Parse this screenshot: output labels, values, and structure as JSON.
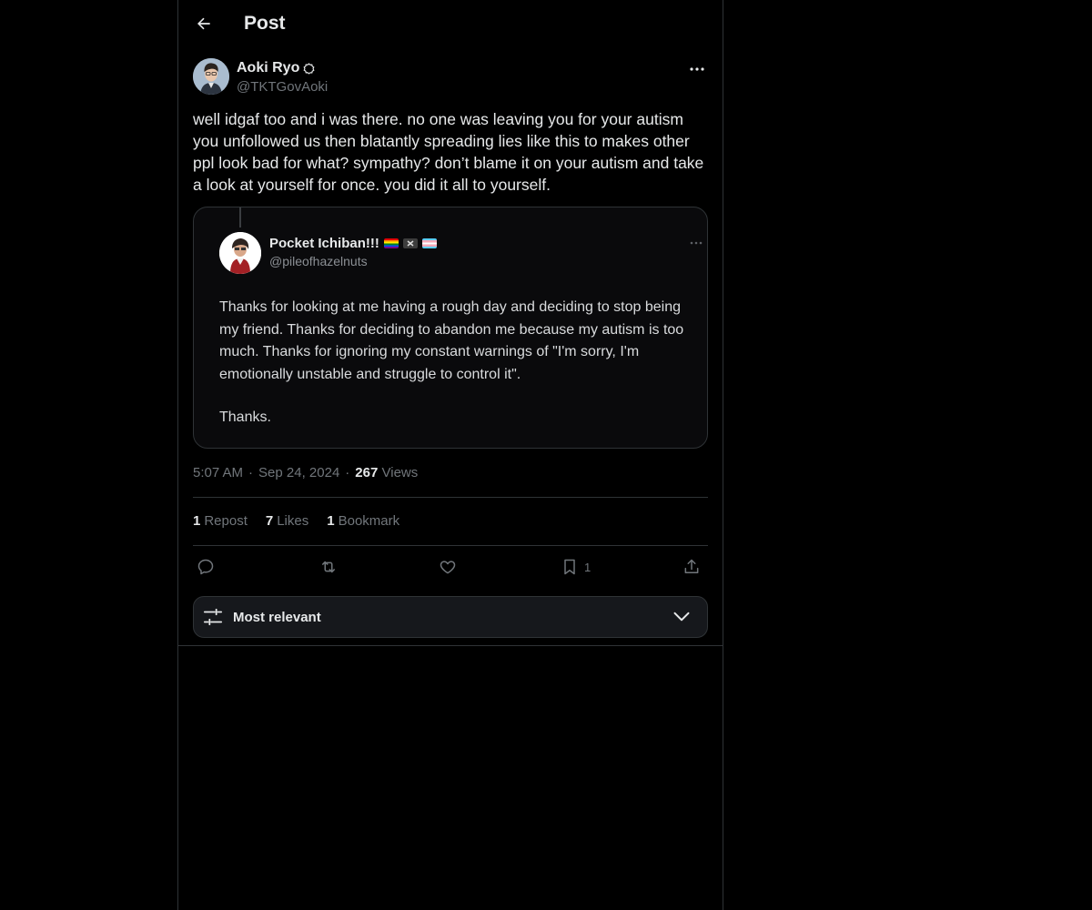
{
  "header": {
    "title": "Post"
  },
  "post": {
    "author_name": "Aoki Ryo",
    "author_handle": "@TKTGovAoki",
    "text": "well idgaf too and i was there. no one was leaving you for your autism you unfollowed us then blatantly spreading lies like this to makes other ppl look bad for what? sympathy? don’t blame it on your autism and take a look at yourself for once. you did it all to yourself.",
    "time": "5:07 AM",
    "date": "Sep 24, 2024",
    "views_count": "267",
    "views_label": "Views"
  },
  "quote": {
    "name": "Pocket Ichiban!!!",
    "handle": "@pileofhazelnuts",
    "text": "Thanks for looking at me having a rough day and deciding to stop being my friend. Thanks for deciding to abandon me because my autism is too much. Thanks for ignoring my constant warnings of \"I'm sorry, I'm emotionally unstable and struggle to control it\".",
    "closing": "Thanks.",
    "flag_colors": [
      "#e94b3c",
      "#3d3d3d",
      "#f5a9b8"
    ]
  },
  "stats": {
    "reposts_count": "1",
    "reposts_label": "Repost",
    "likes_count": "7",
    "likes_label": "Likes",
    "bookmarks_count": "1",
    "bookmarks_label": "Bookmark"
  },
  "actions": {
    "reply_icon": "reply-icon",
    "repost_icon": "repost-icon",
    "like_icon": "heart-icon",
    "bookmark_icon": "bookmark-icon",
    "bookmark_count": "1",
    "share_icon": "share-icon"
  },
  "sort": {
    "label": "Most relevant"
  },
  "colors": {
    "background": "#000000",
    "text": "#e7e9ea",
    "muted": "#71767b",
    "border": "#2f3336"
  }
}
